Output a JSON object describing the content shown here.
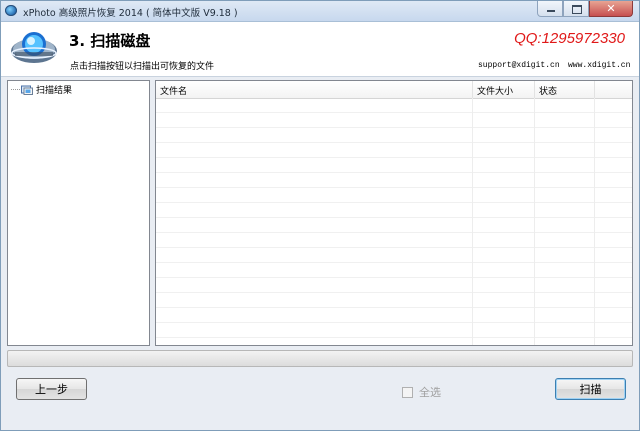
{
  "window": {
    "title": "xPhoto 高级照片恢复 2014 ( 简体中文版 V9.18 )"
  },
  "header": {
    "step_title": "3. 扫描磁盘",
    "description": "点击扫描按钮以扫描出可恢复的文件",
    "qq": "QQ:1295972330",
    "support_email": "support@xdigit.cn",
    "website": "www.xdigit.cn"
  },
  "tree": {
    "root_label": "扫描结果"
  },
  "list": {
    "columns": [
      "文件名",
      "文件大小",
      "状态"
    ],
    "rows": []
  },
  "progress": {
    "value_percent": 0
  },
  "footer": {
    "prev_label": "上一步",
    "select_all_label": "全选",
    "select_all_checked": false,
    "select_all_enabled": false,
    "scan_label": "扫描"
  },
  "icons": {
    "app": "xphoto-app-icon",
    "logo": "xphoto-logo-icon",
    "tree_root": "scan-results-icon"
  }
}
